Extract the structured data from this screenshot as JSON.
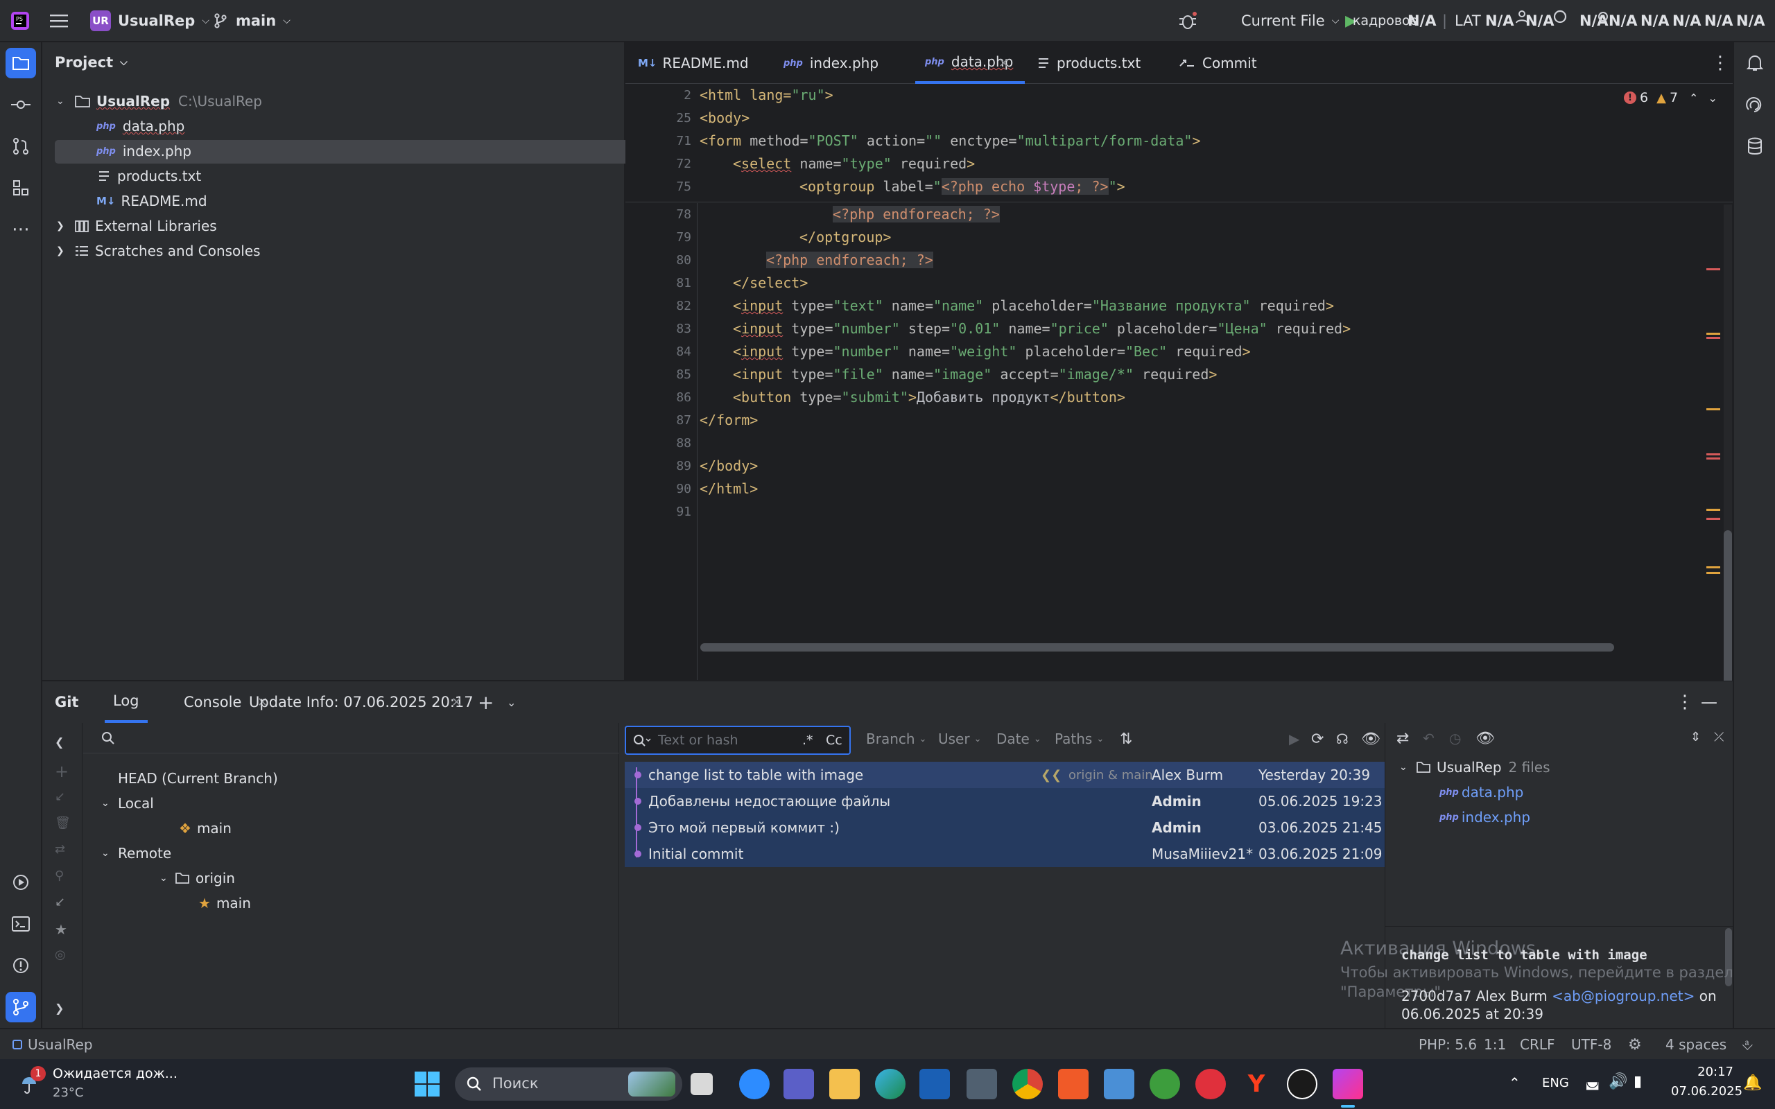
{
  "titlebar": {
    "project_badge": "UR",
    "project_name": "UsualRep",
    "branch": "main",
    "run_config": "Current File",
    "kb_layout": "кадровое",
    "lang": "LAT",
    "na": "N/A"
  },
  "project_panel": {
    "title": "Project",
    "root_name": "UsualRep",
    "root_path": "C:\\UsualRep",
    "files": [
      {
        "name": "data.php",
        "type": "php"
      },
      {
        "name": "index.php",
        "type": "php"
      },
      {
        "name": "products.txt",
        "type": "txt"
      },
      {
        "name": "README.md",
        "type": "md"
      }
    ],
    "external_libraries": "External Libraries",
    "scratches": "Scratches and Consoles"
  },
  "editor": {
    "tabs": [
      {
        "label": "README.md",
        "icon": "markdown-icon"
      },
      {
        "label": "index.php",
        "icon": "php-icon"
      },
      {
        "label": "data.php",
        "icon": "php-icon",
        "active": true
      },
      {
        "label": "products.txt",
        "icon": "text-icon"
      },
      {
        "label": "Commit",
        "icon": "commit-icon"
      }
    ],
    "errors": "6",
    "warnings": "7",
    "sticky": [
      {
        "num": "2"
      },
      {
        "num": "25"
      },
      {
        "num": "71"
      },
      {
        "num": "72"
      },
      {
        "num": "75"
      }
    ],
    "lines": [
      {
        "num": "78"
      },
      {
        "num": "79"
      },
      {
        "num": "80"
      },
      {
        "num": "81"
      },
      {
        "num": "82"
      },
      {
        "num": "83"
      },
      {
        "num": "84"
      },
      {
        "num": "85"
      },
      {
        "num": "86"
      },
      {
        "num": "87"
      },
      {
        "num": "88"
      },
      {
        "num": "89"
      },
      {
        "num": "90"
      },
      {
        "num": "91"
      }
    ],
    "code": {
      "l2_a": "<html lang=",
      "l2_b": "\"ru\"",
      "l2_c": ">",
      "l25": "<body>",
      "l71_a": "<form ",
      "l71_b": "method=",
      "l71_c": "\"POST\"",
      "l71_d": " action=",
      "l71_e": "\"\"",
      "l71_f": " enctype=",
      "l71_g": "\"multipart/form-data\"",
      "l71_h": ">",
      "l72_a": "<",
      "l72_b": "select",
      "l72_c": " name=",
      "l72_d": "\"type\"",
      "l72_e": " required",
      "l72_f": ">",
      "l75_a": "<optgroup ",
      "l75_b": "label=",
      "l75_c": "\"",
      "l75_d": "<?php echo ",
      "l75_e": "$type",
      "l75_f": "; ?>",
      "l75_g": "\"",
      "l75_h": ">",
      "l78": "<?php endforeach; ?>",
      "l79": "</optgroup>",
      "l80": "<?php endforeach; ?>",
      "l81": "</select>",
      "l82_a": "<",
      "l82_b": "input",
      "l82_c": " type=",
      "l82_d": "\"text\"",
      "l82_e": " name=",
      "l82_f": "\"name\"",
      "l82_g": " placeholder=",
      "l82_h": "\"Название продукта\"",
      "l82_i": " required",
      "l82_j": ">",
      "l83_a": "<",
      "l83_b": "input",
      "l83_c": " type=",
      "l83_d": "\"number\"",
      "l83_e": " step=",
      "l83_f": "\"0.01\"",
      "l83_g": " name=",
      "l83_h": "\"price\"",
      "l83_i": " placeholder=",
      "l83_j": "\"Цена\"",
      "l83_k": " required",
      "l83_l": ">",
      "l84_a": "<",
      "l84_b": "input",
      "l84_c": " type=",
      "l84_d": "\"number\"",
      "l84_e": " name=",
      "l84_f": "\"weight\"",
      "l84_g": " placeholder=",
      "l84_h": "\"Вес\"",
      "l84_i": " required",
      "l84_j": ">",
      "l85_a": "<input ",
      "l85_b": "type=",
      "l85_c": "\"file\"",
      "l85_d": " name=",
      "l85_e": "\"image\"",
      "l85_f": " accept=",
      "l85_g": "\"image/*\"",
      "l85_h": " required",
      "l85_i": ">",
      "l86_a": "<button ",
      "l86_b": "type=",
      "l86_c": "\"submit\"",
      "l86_d": ">",
      "l86_e": "Добавить продукт",
      "l86_f": "</button>",
      "l87": "</form>",
      "l89": "</body>",
      "l90": "</html>"
    }
  },
  "git": {
    "tabs": {
      "git": "Git",
      "log": "Log",
      "console": "Console",
      "update": "Update Info: 07.06.2025 20:17"
    },
    "branches": {
      "head": "HEAD (Current Branch)",
      "local": "Local",
      "local_main": "main",
      "remote": "Remote",
      "origin": "origin",
      "remote_main": "main"
    },
    "filter": {
      "placeholder": "Text or hash",
      "regex": ".*",
      "case": "Cc",
      "branch": "Branch",
      "user": "User",
      "date": "Date",
      "paths": "Paths"
    },
    "commits": [
      {
        "message": "change list to table with image",
        "refs": "origin & main",
        "author": "Alex Burm",
        "date": "Yesterday 20:39"
      },
      {
        "message": "Добавлены недостающие файлы",
        "author": "Admin",
        "date": "05.06.2025 19:23"
      },
      {
        "message": "Это мой первый коммит :)",
        "author": "Admin",
        "date": "03.06.2025 21:45"
      },
      {
        "message": "Initial commit",
        "author": "MusaMiiiev21*",
        "date": "03.06.2025 21:09"
      }
    ],
    "changes": {
      "root": "UsualRep",
      "count": "2 files",
      "files": [
        "data.php",
        "index.php"
      ]
    },
    "details": {
      "message": "change list to table with image",
      "hash_author": "2700d7a7 Alex Burm",
      "email": "<ab@piogroup.net>",
      "on": "on",
      "date": "06.06.2025 at 20:39"
    },
    "watermark": {
      "title": "Активация Windows",
      "line1": "Чтобы активировать Windows, перейдите в раздел",
      "line2": "\"Параметры\"."
    }
  },
  "statusbar": {
    "project": "UsualRep",
    "php": "PHP: 5.6",
    "pos": "1:1",
    "eol": "CRLF",
    "enc": "UTF-8",
    "indent": "4 spaces"
  },
  "taskbar": {
    "weather_title": "Ожидается дож...",
    "weather_temp": "23°C",
    "weather_badge": "1",
    "search": "Поиск",
    "lang": "ENG",
    "time": "20:17",
    "date": "07.06.2025"
  },
  "colors": {
    "accent": "#3574f0",
    "panel": "#2b2d30",
    "editor_bg": "#1e1f22",
    "commit_selected": "#2e436e"
  }
}
